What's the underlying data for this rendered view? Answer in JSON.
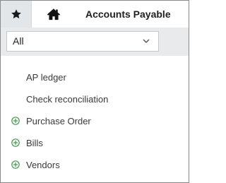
{
  "header": {
    "favorites_icon": "star-icon",
    "home_icon": "home-icon",
    "title": "Accounts Payable"
  },
  "filter": {
    "selected": "All",
    "caret_icon": "chevron-down-icon"
  },
  "menu": {
    "items": [
      {
        "label": "AP ledger",
        "expandable": false
      },
      {
        "label": "Check reconciliation",
        "expandable": false
      },
      {
        "label": "Purchase Order",
        "expandable": true
      },
      {
        "label": "Bills",
        "expandable": true
      },
      {
        "label": "Vendors",
        "expandable": true
      }
    ]
  },
  "colors": {
    "accent_green": "#3e9b47",
    "tab_active_bg": "#e3e6e9",
    "filter_band_bg": "#e8eaec"
  }
}
